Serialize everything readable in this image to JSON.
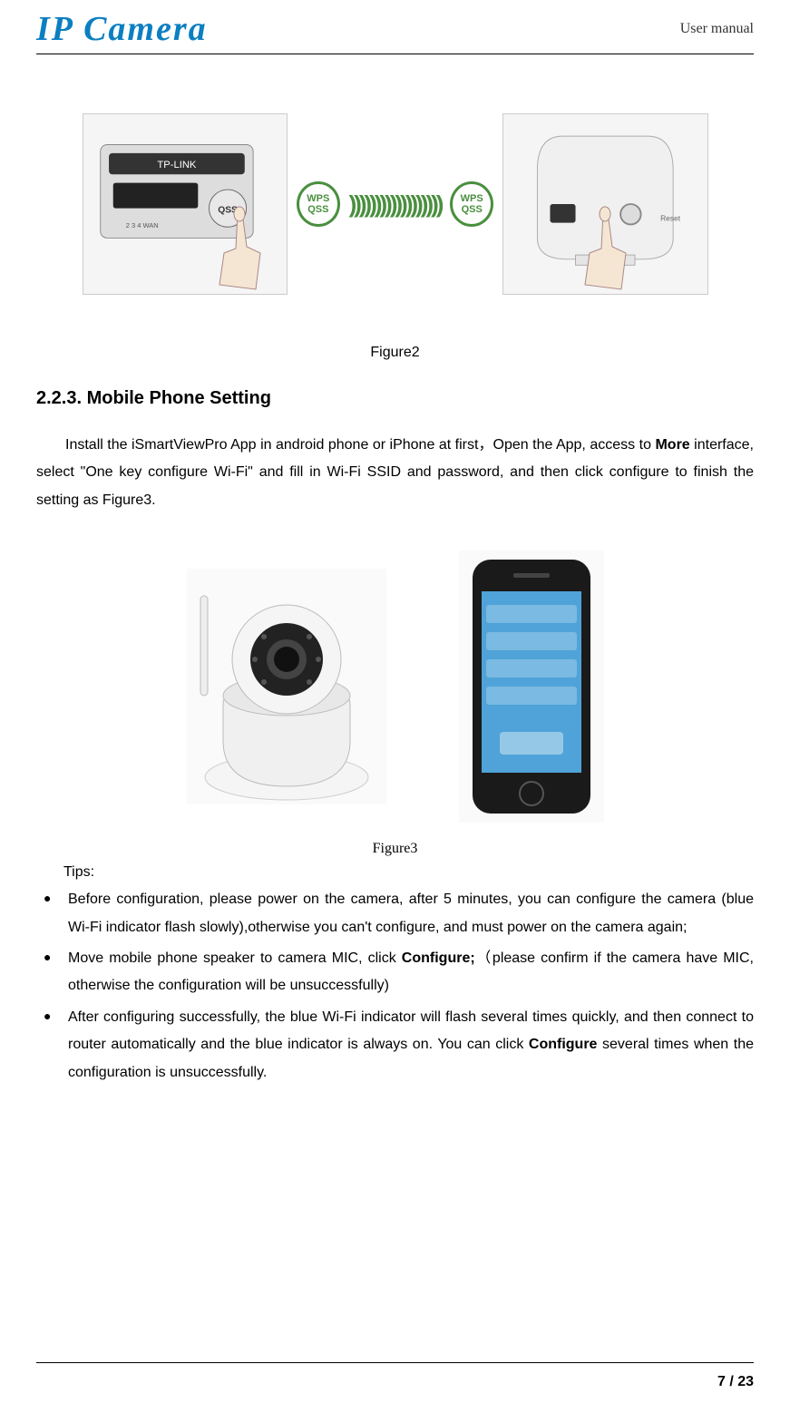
{
  "header": {
    "logo": "IP Camera",
    "right": "User manual"
  },
  "figure2": {
    "badge_line1": "WPS",
    "badge_line2": "QSS",
    "waves": "))))))))))))))))))",
    "caption": "Figure2"
  },
  "section": {
    "heading": "2.2.3.  Mobile Phone Setting",
    "para_pre": "Install the iSmartViewPro App in android phone or iPhone at first，Open the App, access to ",
    "para_bold": "More",
    "para_post": " interface, select \"One key configure Wi-Fi\" and fill in Wi-Fi SSID and password, and then click configure to finish the setting as Figure3."
  },
  "figure3": {
    "caption": "Figure3"
  },
  "tips": {
    "label": "Tips:",
    "items": [
      {
        "pre": "Before configuration, please power on the camera, after 5 minutes, you can configure the camera (blue Wi-Fi indicator flash slowly),otherwise you can't configure, and must power on the camera again;",
        "bold": "",
        "post": ""
      },
      {
        "pre": "Move mobile phone speaker to camera MIC, click ",
        "bold": "Configure;",
        "post": "（please confirm if the camera have MIC, otherwise the configuration will be unsuccessfully)"
      },
      {
        "pre": "After configuring successfully, the blue Wi-Fi indicator will flash several times quickly, and then connect to router automatically and the blue indicator is always on. You can click ",
        "bold": "Configure",
        "post": " several times when the configuration is unsuccessfully."
      }
    ]
  },
  "footer": {
    "page": "7 / 23"
  }
}
